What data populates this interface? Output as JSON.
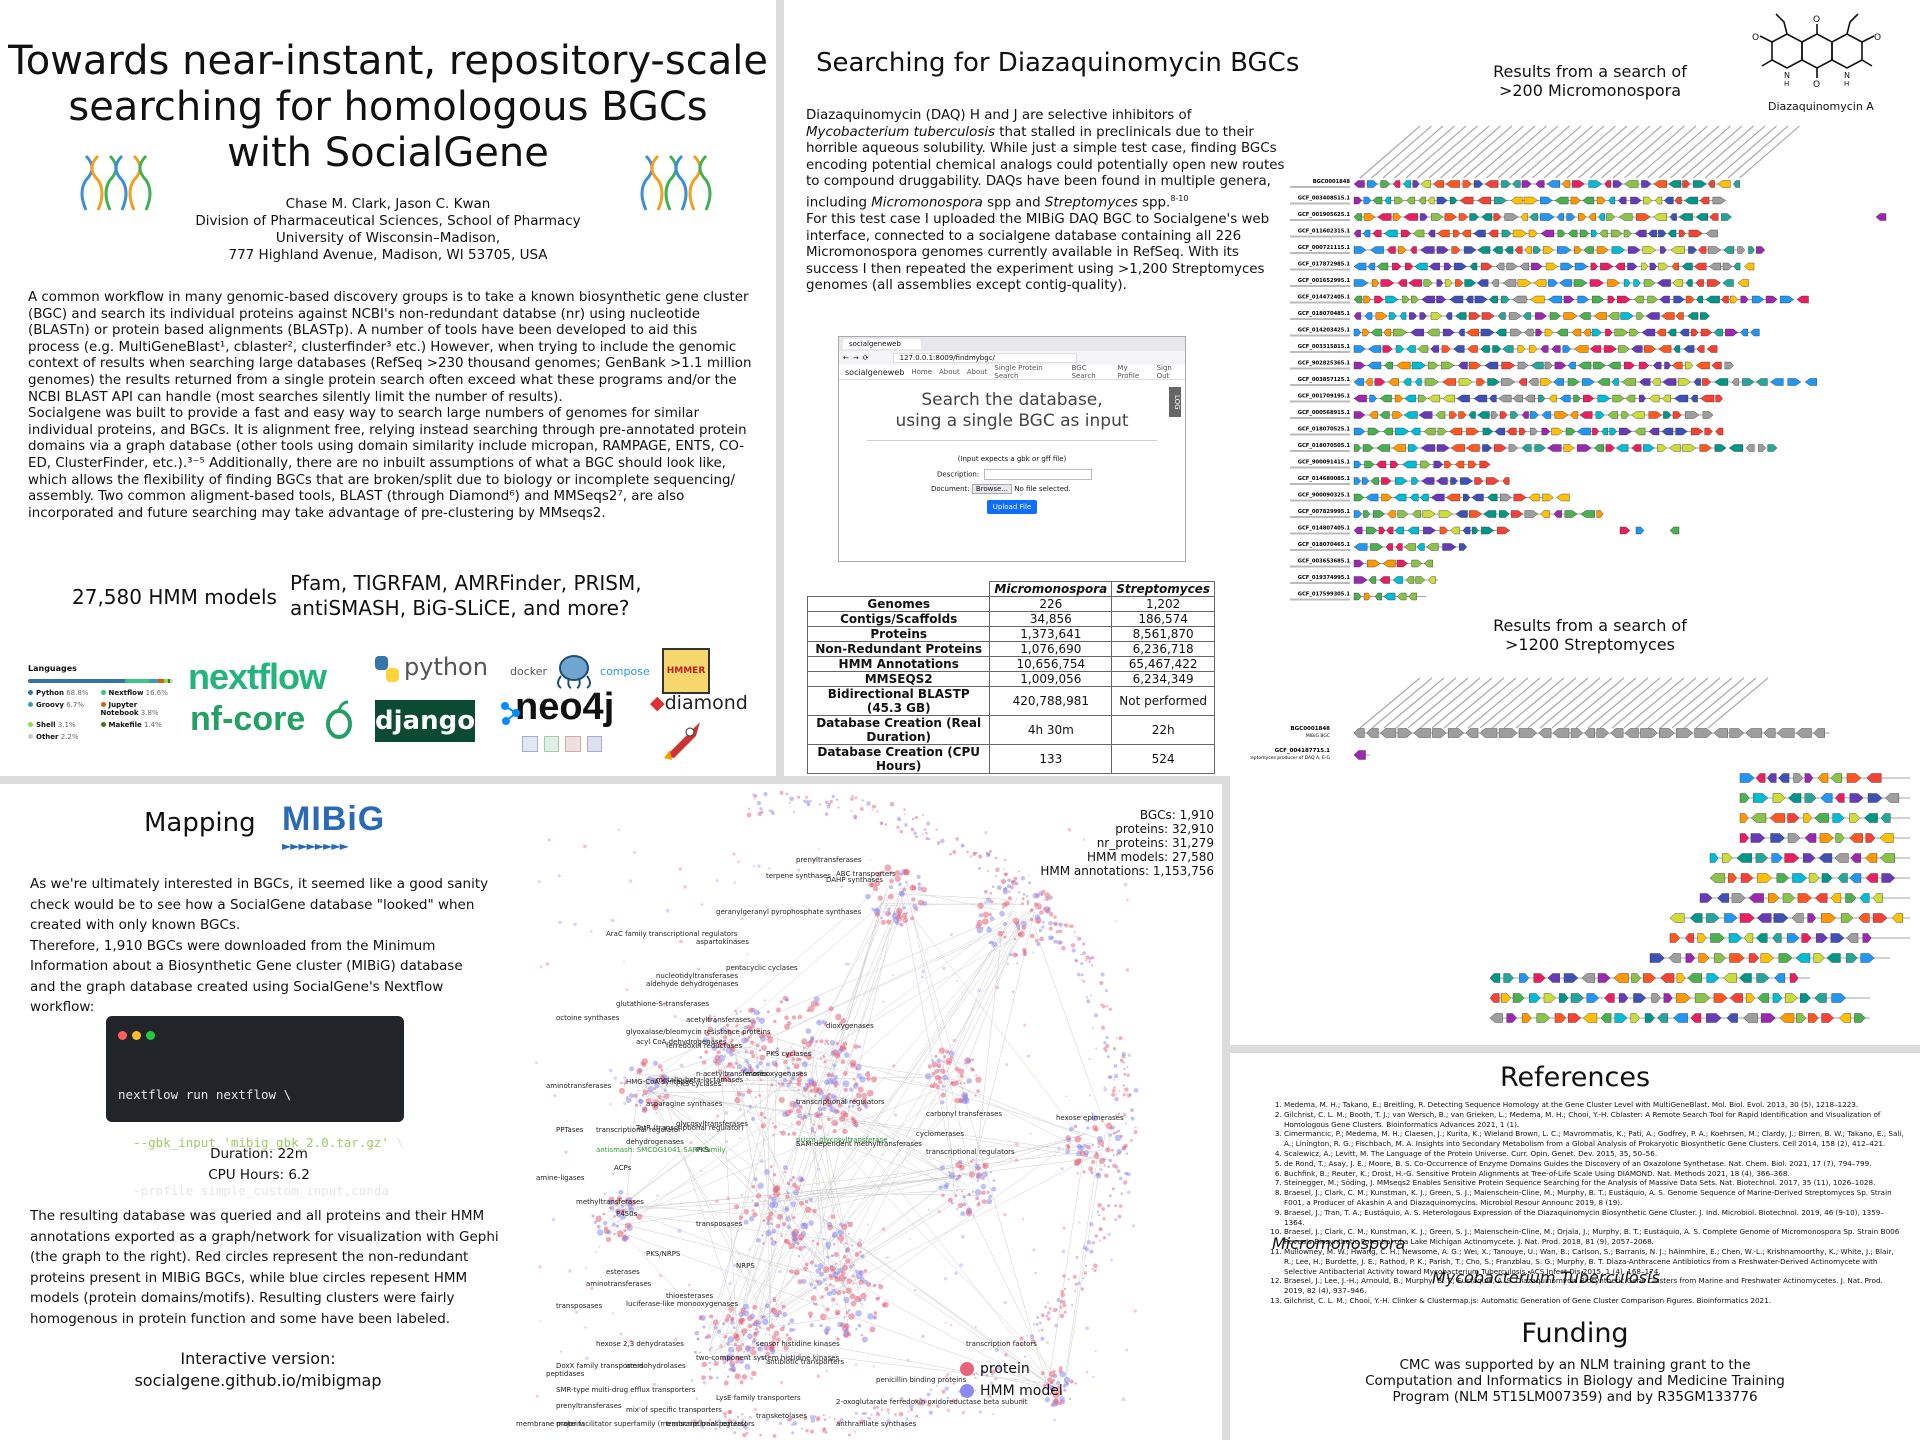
{
  "title": {
    "line1": "Towards near-instant, repository-scale",
    "line2": "searching for homologous BGCs",
    "line3": "with SocialGene"
  },
  "authors": {
    "names": "Chase M. Clark, Jason C. Kwan",
    "dept": "Division of Pharmaceutical Sciences, School of Pharmacy",
    "univ": "University of Wisconsin–Madison,",
    "addr": "777 Highland Avenue, Madison, WI 53705, USA"
  },
  "intro": {
    "p1": "A common workflow in many genomic-based discovery groups is to take a known biosynthetic gene cluster (BGC) and search its individual proteins against NCBI's non-redundant databse (nr) using nucleotide (BLASTn) or protein based alignments (BLASTp). A number of tools have been developed to aid this process (e.g. MultiGeneBlast¹, cblaster², clusterfinder³ etc.) However, when trying to include the genomic context of results when searching large databases (RefSeq >230 thousand genomes; GenBank >1.1 million genomes) the results returned from a single protein search often exceed what these programs and/or the NCBI BLAST API can handle (most searches silently limit the number of results).",
    "p2": "Socialgene was built to provide a fast and easy way to search large numbers of genomes for similar individual proteins, and BGCs. It is alignment free, relying instead searching through pre-annotated protein domains via a graph database (other tools using domain similarity include micropan, RAMPAGE, ENTS, CO-ED, ClusterFinder, etc.).³⁻⁵  Additionally, there are no inbuilt assumptions of what a BGC should look like, which allows the flexibility of finding BGCs that are broken/split due to biology or incomplete sequencing/ assembly. Two common aligment-based tools, BLAST (through Diamond⁶) and MMSeqs2⁷, are also incorporated and future searching may take advantage of pre-clustering by MMseqs2."
  },
  "hmm": {
    "count": "27,580 HMM models",
    "sources1": "Pfam, TIGRFAM, AMRFinder, PRISM,",
    "sources2": "antiSMASH, BiG-SLiCE, and more?"
  },
  "languages": {
    "title": "Languages",
    "items": [
      {
        "name": "Python",
        "pct": "68.8%",
        "color": "#3572a5"
      },
      {
        "name": "Nextflow",
        "pct": "16.6%",
        "color": "#3ac486"
      },
      {
        "name": "Groovy",
        "pct": "6.7%",
        "color": "#4298b8"
      },
      {
        "name": "Jupyter Notebook",
        "pct": "3.8%",
        "color": "#da5b0b"
      },
      {
        "name": "Shell",
        "pct": "3.1%",
        "color": "#89e051"
      },
      {
        "name": "Makefile",
        "pct": "1.4%",
        "color": "#427819"
      },
      {
        "name": "Other",
        "pct": "2.2%",
        "color": "#cccccc"
      }
    ]
  },
  "logos": {
    "nextflow": "nextflow",
    "nfcore": "nf-core",
    "python": "python",
    "django": "django",
    "docker": "docker",
    "compose": "compose",
    "neo4j": "neo4j",
    "diamond": "diamond",
    "hmmer": "HMMER",
    "mibig": "MIBiG"
  },
  "daq": {
    "title": "Searching for Diazaquinomycin BGCs",
    "p1a": "Diazaquinomycin (DAQ) H and J are selective inhibitors of ",
    "p1b": "Mycobacterium tuberculosis",
    "p1c": " that stalled in preclinicals due to their horrible aqueous solubility. While just a simple test case, finding BGCs encoding potential chemical analogs could potentially open new routes to compound druggability. DAQs have been found in multiple genera, including ",
    "p1d": "Micromonospora",
    "p1e": " spp and ",
    "p1f": "Streptomyces",
    "p1g": " spp.",
    "p1sup": "8-10",
    "p2": "For this test case I uploaded the MIBiG DAQ BGC to Socialgene's web interface, connected to a socialgene database containing all 226 Micromonospora genomes currently available in RefSeq. With its success I then repeated the experiment using >1,200 Streptomyces genomes (all assemblies except contig-quality).",
    "compound": "Diazaquinomycin A",
    "res1_line1": "Results from a search of",
    "res1_line2": ">200 Micromonospora",
    "res2_line1": "Results from a search of",
    "res2_line2": ">1200 Streptomyces"
  },
  "browser": {
    "tab": "socialgeneweb",
    "url": "127.0.0.1:8009/findmybgc/",
    "brand": "socialgeneweb",
    "nav": [
      "Home",
      "About",
      "About",
      "Single Protein Search",
      "BGC Search",
      "My Profile",
      "Sign Out"
    ],
    "heading1": "Search the database,",
    "heading2": "using a single BGC as input",
    "hint": "(Input expects a gbk or gff file)",
    "desc_label": "Description:",
    "doc_label": "Document:",
    "browse": "Browse...",
    "nofile": "No file selected.",
    "upload": "Upload File",
    "side": "LOG"
  },
  "stats": {
    "headers": [
      "",
      "Micromonospora",
      "Streptomyces"
    ],
    "rows": [
      [
        "Genomes",
        "226",
        "1,202"
      ],
      [
        "Contigs/Scaffolds",
        "34,856",
        "186,574"
      ],
      [
        "Proteins",
        "1,373,641",
        "8,561,870"
      ],
      [
        "Non-Redundant Proteins",
        "1,076,690",
        "6,236,718"
      ],
      [
        "HMM Annotations",
        "10,656,754",
        "65,467,422"
      ],
      [
        "MMSEQS2",
        "1,009,056",
        "6,234,349"
      ],
      [
        "Bidirectional BLASTP (45.3 GB)",
        "420,788,981",
        "Not performed"
      ],
      [
        "Database Creation (Real Duration)",
        "4h 30m",
        "22h"
      ],
      [
        "Database Creation (CPU Hours)",
        "133",
        "524"
      ]
    ]
  },
  "micro_hits": {
    "labels": [
      "BGC0001848",
      "GCF_003408515.1",
      "GCF_001905625.1",
      "GCF_011602315.1",
      "GCF_000721115.1",
      "GCF_017872985.1",
      "GCF_001652995.1",
      "GCF_014472405.1",
      "GCF_018070485.1",
      "GCF_014203425.1",
      "GCF_003315815.1",
      "GCF_902825365.1",
      "GCF_003857125.1",
      "GCF_001709195.1",
      "GCF_000568915.1",
      "GCF_018070525.1",
      "GCF_018070505.1",
      "GCF_900091415.1",
      "GCF_014680085.1",
      "GCF_900090325.1",
      "GCF_007829995.1",
      "GCF_014807405.1",
      "GCF_018070465.1",
      "GCF_003653685.1",
      "GCF_019374995.1",
      "GCF_017599305.1"
    ]
  },
  "strep_hits": {
    "labels": [
      "BGC0001848",
      "GCF_004187715.1"
    ],
    "sublabels": [
      "MIBiG BGC",
      "Streptomyces producer of DAQ A, E-G"
    ]
  },
  "mapping": {
    "title": "Mapping",
    "p1": "As we're ultimately interested in BGCs, it seemed like a good sanity check would be to see how a SocialGene database \"looked\" when created with only known BGCs.",
    "p2": "Therefore, 1,910 BGCs were downloaded from the Minimum Information about a Biosynthetic Gene cluster (MIBiG) database and the graph database created using SocialGene's Nextflow workflow:",
    "code1": "nextflow run nextflow \\",
    "code2a": "  --gbk_input ",
    "code2b": "'mibig_gbk_2.0.tar.gz'",
    "code2c": " \\",
    "code3": "  -profile simple_custom_input,conda",
    "duration": "Duration: 22m",
    "cpu": "CPU Hours: 6.2",
    "p3": "The resulting database was queried and all proteins and their HMM annotations exported as a graph/network for visualization with Gephi (the graph to the right). Red circles represent the non-redundant proteins present in MIBiG BGCs, while blue circles repesent HMM models (protein domains/motifs). Resulting clusters were fairly homogenous in protein function and some have been labeled.",
    "interactive": "Interactive version:",
    "link": "socialgene.github.io/mibigmap"
  },
  "network": {
    "stats": [
      "BGCs: 1,910",
      "proteins: 32,910",
      "nr_proteins: 31,279",
      "HMM models: 27,580",
      "HMM annotations: 1,153,756"
    ],
    "legend_protein": "protein",
    "legend_hmm": "HMM model",
    "colors": {
      "protein": "#e8627a",
      "hmm": "#8a8cf0"
    },
    "labels": [
      "prenyltransferases",
      "terpene synthases",
      "DAHP synthases",
      "geranylgeranyl pyrophosphate synthases",
      "AraC family transcriptional regulators",
      "aspartokinases",
      "pentacyclic cyclases",
      "nucleotidyltransferases",
      "aldehyde dehydrogenases",
      "glutathione-S-transferases",
      "octoine synthases",
      "acetyltransferases",
      "glyoxalase/bleomycin resistance proteins",
      "acyl CoA dehydrogenases",
      "dioxygenases",
      "ferredoxin reductases",
      "PKS cyclases",
      "PKS cyclases",
      "metallo-beta-lactamases",
      "aminotransferases",
      "n-acetyltransferases",
      "asparagine synthases",
      "monooxygenases",
      "HMG-CoA synthase",
      "PPTases",
      "TetR (transcriptional regulator)",
      "transcriptional regulators",
      "glycosyltransferases",
      "dehydrogenases",
      "ACPs",
      "prism_glycosyltransferase",
      "SAM-dependent methyltransferases",
      "PKS",
      "antismash: SMCOG1041 SARP family",
      "methyltransferases",
      "P450s",
      "transposases",
      "PKS/NRPS",
      "esterases",
      "aminotransferases",
      "NRPS",
      "thioesterases",
      "carbonyl transferases",
      "cyclomerases",
      "transcriptional regulators",
      "amine-ligases",
      "transcriptional regulator",
      "transposases",
      "hexose epimerases",
      "luciferase-like monooxygenases",
      "two-component system histidine kinases",
      "sensor histidine kinases",
      "hexose 2,3 dehydratases",
      "amidohydrolases",
      "DoxX family transporters",
      "peptidases",
      "SMR-type multi-drug efflux transporters",
      "LysE family transporters",
      "prenyltransferases",
      "membrane proteins",
      "antibiotic transporters",
      "mix of specific transporters",
      "major facilitator superfamily (membrane transporters)",
      "transcriptional regulators",
      "transketolases",
      "2-oxoglutarate ferredoxin oxidoreductase beta subunit",
      "penicillin binding proteins",
      "transcription factors",
      "anthranilate synthases",
      "ABC transporters"
    ]
  },
  "references": {
    "title": "References",
    "items": [
      "Medema, M. H.; Takano, E.; Breitling, R. Detecting Sequence Homology at the Gene Cluster Level with MultiGeneBlast. Mol. Biol. Evol. 2013, 30 (5), 1218–1223.",
      "Gilchrist, C. L. M.; Booth, T. J.; van Wersch, B.; van Grieken, L.; Medema, M. H.; Chooi, Y.-H. Cblaster: A Remote Search Tool for Rapid Identification and Visualization of Homologous Gene Clusters. Bioinformatics Advances 2021, 1 (1).",
      "Cimermancic, P.; Medema, M. H.; Claesen, J.; Kurita, K.; Wieland Brown, L. C.; Mavrommatis, K.; Pati, A.; Godfrey, P. A.; Koehrsen, M.; Clardy, J.; Birren, B. W.; Takano, E.; Sali, A.; Linington, R. G.; Fischbach, M. A. Insights into Secondary Metabolism from a Global Analysis of Prokaryotic Biosynthetic Gene Clusters. Cell 2014, 158 (2), 412–421.",
      "Scalewicz, A.; Levitt, M. The Language of the Protein Universe. Curr. Opin. Genet. Dev. 2015, 35, 50–56.",
      "de Rond, T.; Asay, J. E.; Moore, B. S. Co-Occurrence of Enzyme Domains Guides the Discovery of an Oxazolone Synthetase. Nat. Chem. Biol. 2021, 17 (7), 794–799.",
      "Buchfink, B.; Reuter, K.; Drost, H.-G. Sensitive Protein Alignments at Tree-of-Life Scale Using DIAMOND. Nat. Methods 2021, 18 (4), 366–368.",
      "Steinegger, M.; Söding, J. MMseqs2 Enables Sensitive Protein Sequence Searching for the Analysis of Massive Data Sets. Nat. Biotechnol. 2017, 35 (11), 1026–1028.",
      "Braesel, J.; Clark, C. M.; Kunstman, K. J.; Green, S. J.; Maienschein-Cline, M.; Murphy, B. T.; Eustáquio, A. S. Genome Sequence of Marine-Derived Streptomyces  Sp. Strain F001, a Producer of Akashin A and Diazaquinomycins. Microbiol Resour Announc 2019, 8 (19).",
      "Braesel, J.; Tran, T. A.; Eustáquio, A. S. Heterologous Expression of the Diazaquinomycin Biosynthetic Gene Cluster. J. Ind. Microbiol. Biotechnol. 2019, 46 (9-10), 1359–1364.",
      "Braesel, J.; Clark, C. M.; Kunstman, K. J.; Green, S. J.; Maienschein-Cline, M.; Orjala, J.; Murphy, B. T.; Eustáquio, A. S. Complete Genome of Micromonospora  Sp. Strain B006 Reveals Biosynthetic Potential of a Lake Michigan Actinomycete. J. Nat. Prod. 2018, 81 (9), 2057–2068.",
      "Mullowney, M. W.; Hwang, C. H.; Newsome, A. G.; Wei, X.; Tanouye, U.; Wan, B.; Carlson, S.; Barranis, N. J.; hAinmhire, E.; Chen, W.-L.; Krishnamoorthy, K.; White, J.; Blair, R.; Lee, H.; Burdette, J. E.; Rathod, P. K.; Parish, T.; Cho, S.; Franzblau, S. G.; Murphy, B. T. Diaza-Anthracene Antibiotics from a Freshwater-Derived Actinomycete with Selective Antibacterial Activity toward Mycobacterium Tuberculosis. ACS Infect Dis 2015, 1 (4), 168–174.",
      "Braesel, J.; Lee, J.-H.; Arnould, B.; Murphy, B. T.; Eustáquio, A. S. Diazaquinomycin Biosynthetic Gene Clusters from Marine and Freshwater Actinomycetes. J. Nat. Prod. 2019, 82 (4), 937–946.",
      "Gilchrist, C. L. M.; Chooi, Y.-H. Clinker & Clustermap.js: Automatic Generation of Gene Cluster Comparison Figures. Bioinformatics 2021."
    ],
    "overlay1": "Micromonospora",
    "overlay2": "Mycobacterium Tuberculosis"
  },
  "funding": {
    "title": "Funding",
    "line1": "CMC was supported by an NLM training grant to the",
    "line2": "Computation and Informatics in Biology and Medicine Training",
    "line3": "Program (NLM 5T15LM007359) and by R35GM133776"
  }
}
